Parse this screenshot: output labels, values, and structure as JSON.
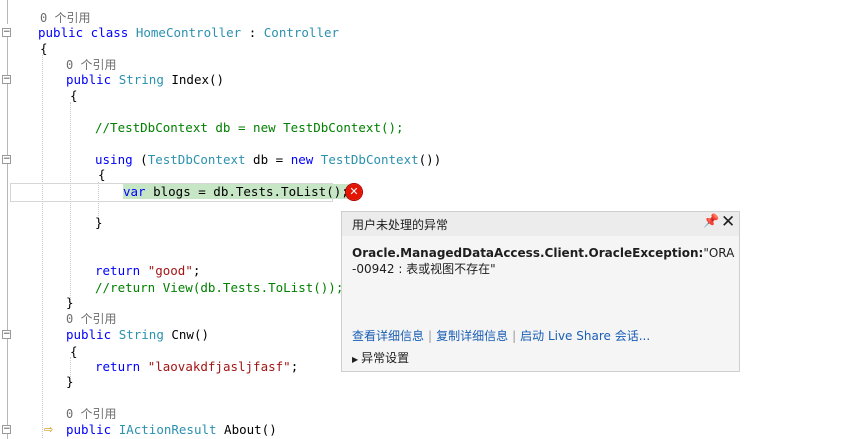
{
  "editor": {
    "lines": [
      {
        "type": "lens",
        "text": "0 个引用"
      },
      {
        "type": "code",
        "tokens": [
          {
            "c": "kw",
            "t": "public class "
          },
          {
            "c": "type",
            "t": "HomeController"
          },
          {
            "c": "punct",
            "t": " : "
          },
          {
            "c": "type",
            "t": "Controller"
          }
        ]
      },
      {
        "type": "code",
        "tokens": [
          {
            "c": "punct",
            "t": "{"
          }
        ]
      },
      {
        "type": "lens",
        "text": "0 个引用"
      },
      {
        "type": "code",
        "tokens": [
          {
            "c": "kw",
            "t": "public "
          },
          {
            "c": "type",
            "t": "String"
          },
          {
            "c": "punct",
            "t": " Index()"
          }
        ]
      },
      {
        "type": "code",
        "tokens": [
          {
            "c": "punct",
            "t": "{"
          }
        ]
      },
      {
        "type": "code",
        "tokens": [
          {
            "c": "cmt",
            "t": "//TestDbContext db = new TestDbContext();"
          }
        ]
      },
      {
        "type": "code",
        "tokens": [
          {
            "c": "kw",
            "t": "using "
          },
          {
            "c": "punct",
            "t": "("
          },
          {
            "c": "type",
            "t": "TestDbContext"
          },
          {
            "c": "punct",
            "t": " db = "
          },
          {
            "c": "kw",
            "t": "new "
          },
          {
            "c": "type",
            "t": "TestDbContext"
          },
          {
            "c": "punct",
            "t": "())"
          }
        ]
      },
      {
        "type": "code",
        "tokens": [
          {
            "c": "punct",
            "t": "{"
          }
        ]
      },
      {
        "type": "code",
        "tokens": [
          {
            "c": "kw",
            "t": "var"
          },
          {
            "c": "punct",
            "t": " blogs = db.Tests.ToList();"
          }
        ]
      },
      {
        "type": "code",
        "tokens": [
          {
            "c": "punct",
            "t": "}"
          }
        ]
      },
      {
        "type": "code",
        "tokens": [
          {
            "c": "kw",
            "t": "return "
          },
          {
            "c": "str",
            "t": "\"good\""
          },
          {
            "c": "punct",
            "t": ";"
          }
        ]
      },
      {
        "type": "code",
        "tokens": [
          {
            "c": "cmt",
            "t": "//return View(db.Tests.ToList());"
          }
        ]
      },
      {
        "type": "code",
        "tokens": [
          {
            "c": "punct",
            "t": "}"
          }
        ]
      },
      {
        "type": "lens",
        "text": "0 个引用"
      },
      {
        "type": "code",
        "tokens": [
          {
            "c": "kw",
            "t": "public "
          },
          {
            "c": "type",
            "t": "String"
          },
          {
            "c": "punct",
            "t": " Cnw()"
          }
        ]
      },
      {
        "type": "code",
        "tokens": [
          {
            "c": "punct",
            "t": "{"
          }
        ]
      },
      {
        "type": "code",
        "tokens": [
          {
            "c": "kw",
            "t": "return "
          },
          {
            "c": "str",
            "t": "\"laovakdfjasljfasf\""
          },
          {
            "c": "punct",
            "t": ";"
          }
        ]
      },
      {
        "type": "code",
        "tokens": [
          {
            "c": "punct",
            "t": "}"
          }
        ]
      },
      {
        "type": "lens",
        "text": "0 个引用"
      },
      {
        "type": "code",
        "tokens": [
          {
            "c": "kw",
            "t": "public "
          },
          {
            "c": "type",
            "t": "IActionResult"
          },
          {
            "c": "punct",
            "t": " About()"
          }
        ]
      }
    ]
  },
  "exception_popup": {
    "title": "用户未处理的异常",
    "pin_icon": "pin-icon",
    "close_icon": "close-icon",
    "exception_type": "Oracle.ManagedDataAccess.Client.OracleException:",
    "exception_message": "\"ORA-00942 : 表或视图不存在\"",
    "links": [
      "查看详细信息",
      "复制详细信息",
      "启动 Live Share 会话..."
    ],
    "settings_label": "异常设置"
  },
  "icons": {
    "error": "error-x-icon",
    "collapse": "collapse-minus-icon",
    "execution_pointer": "execution-pointer-icon"
  },
  "colors": {
    "keyword": "#0000ff",
    "type": "#2b91af",
    "comment": "#008000",
    "string": "#a31515",
    "error": "#e51400",
    "highlight": "#c6e6c6",
    "link": "#1a5fb4"
  }
}
